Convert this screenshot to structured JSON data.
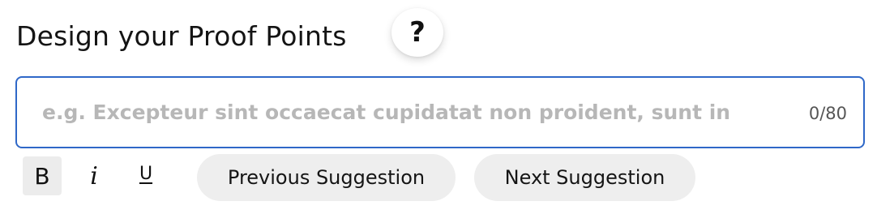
{
  "header": {
    "title": "Design your Proof Points",
    "help_label": "?"
  },
  "input": {
    "value": "",
    "placeholder": "e.g. Excepteur sint occaecat cupidatat non proident, sunt in",
    "counter": "0/80"
  },
  "formatting": {
    "bold_label": "B",
    "italic_label": "i",
    "underline_label": "U"
  },
  "suggestions": {
    "previous_label": "Previous Suggestion",
    "next_label": "Next Suggestion"
  },
  "colors": {
    "focus_border": "#2f68c8",
    "pill_background": "#eeeeee",
    "placeholder": "#b7b7b7"
  }
}
